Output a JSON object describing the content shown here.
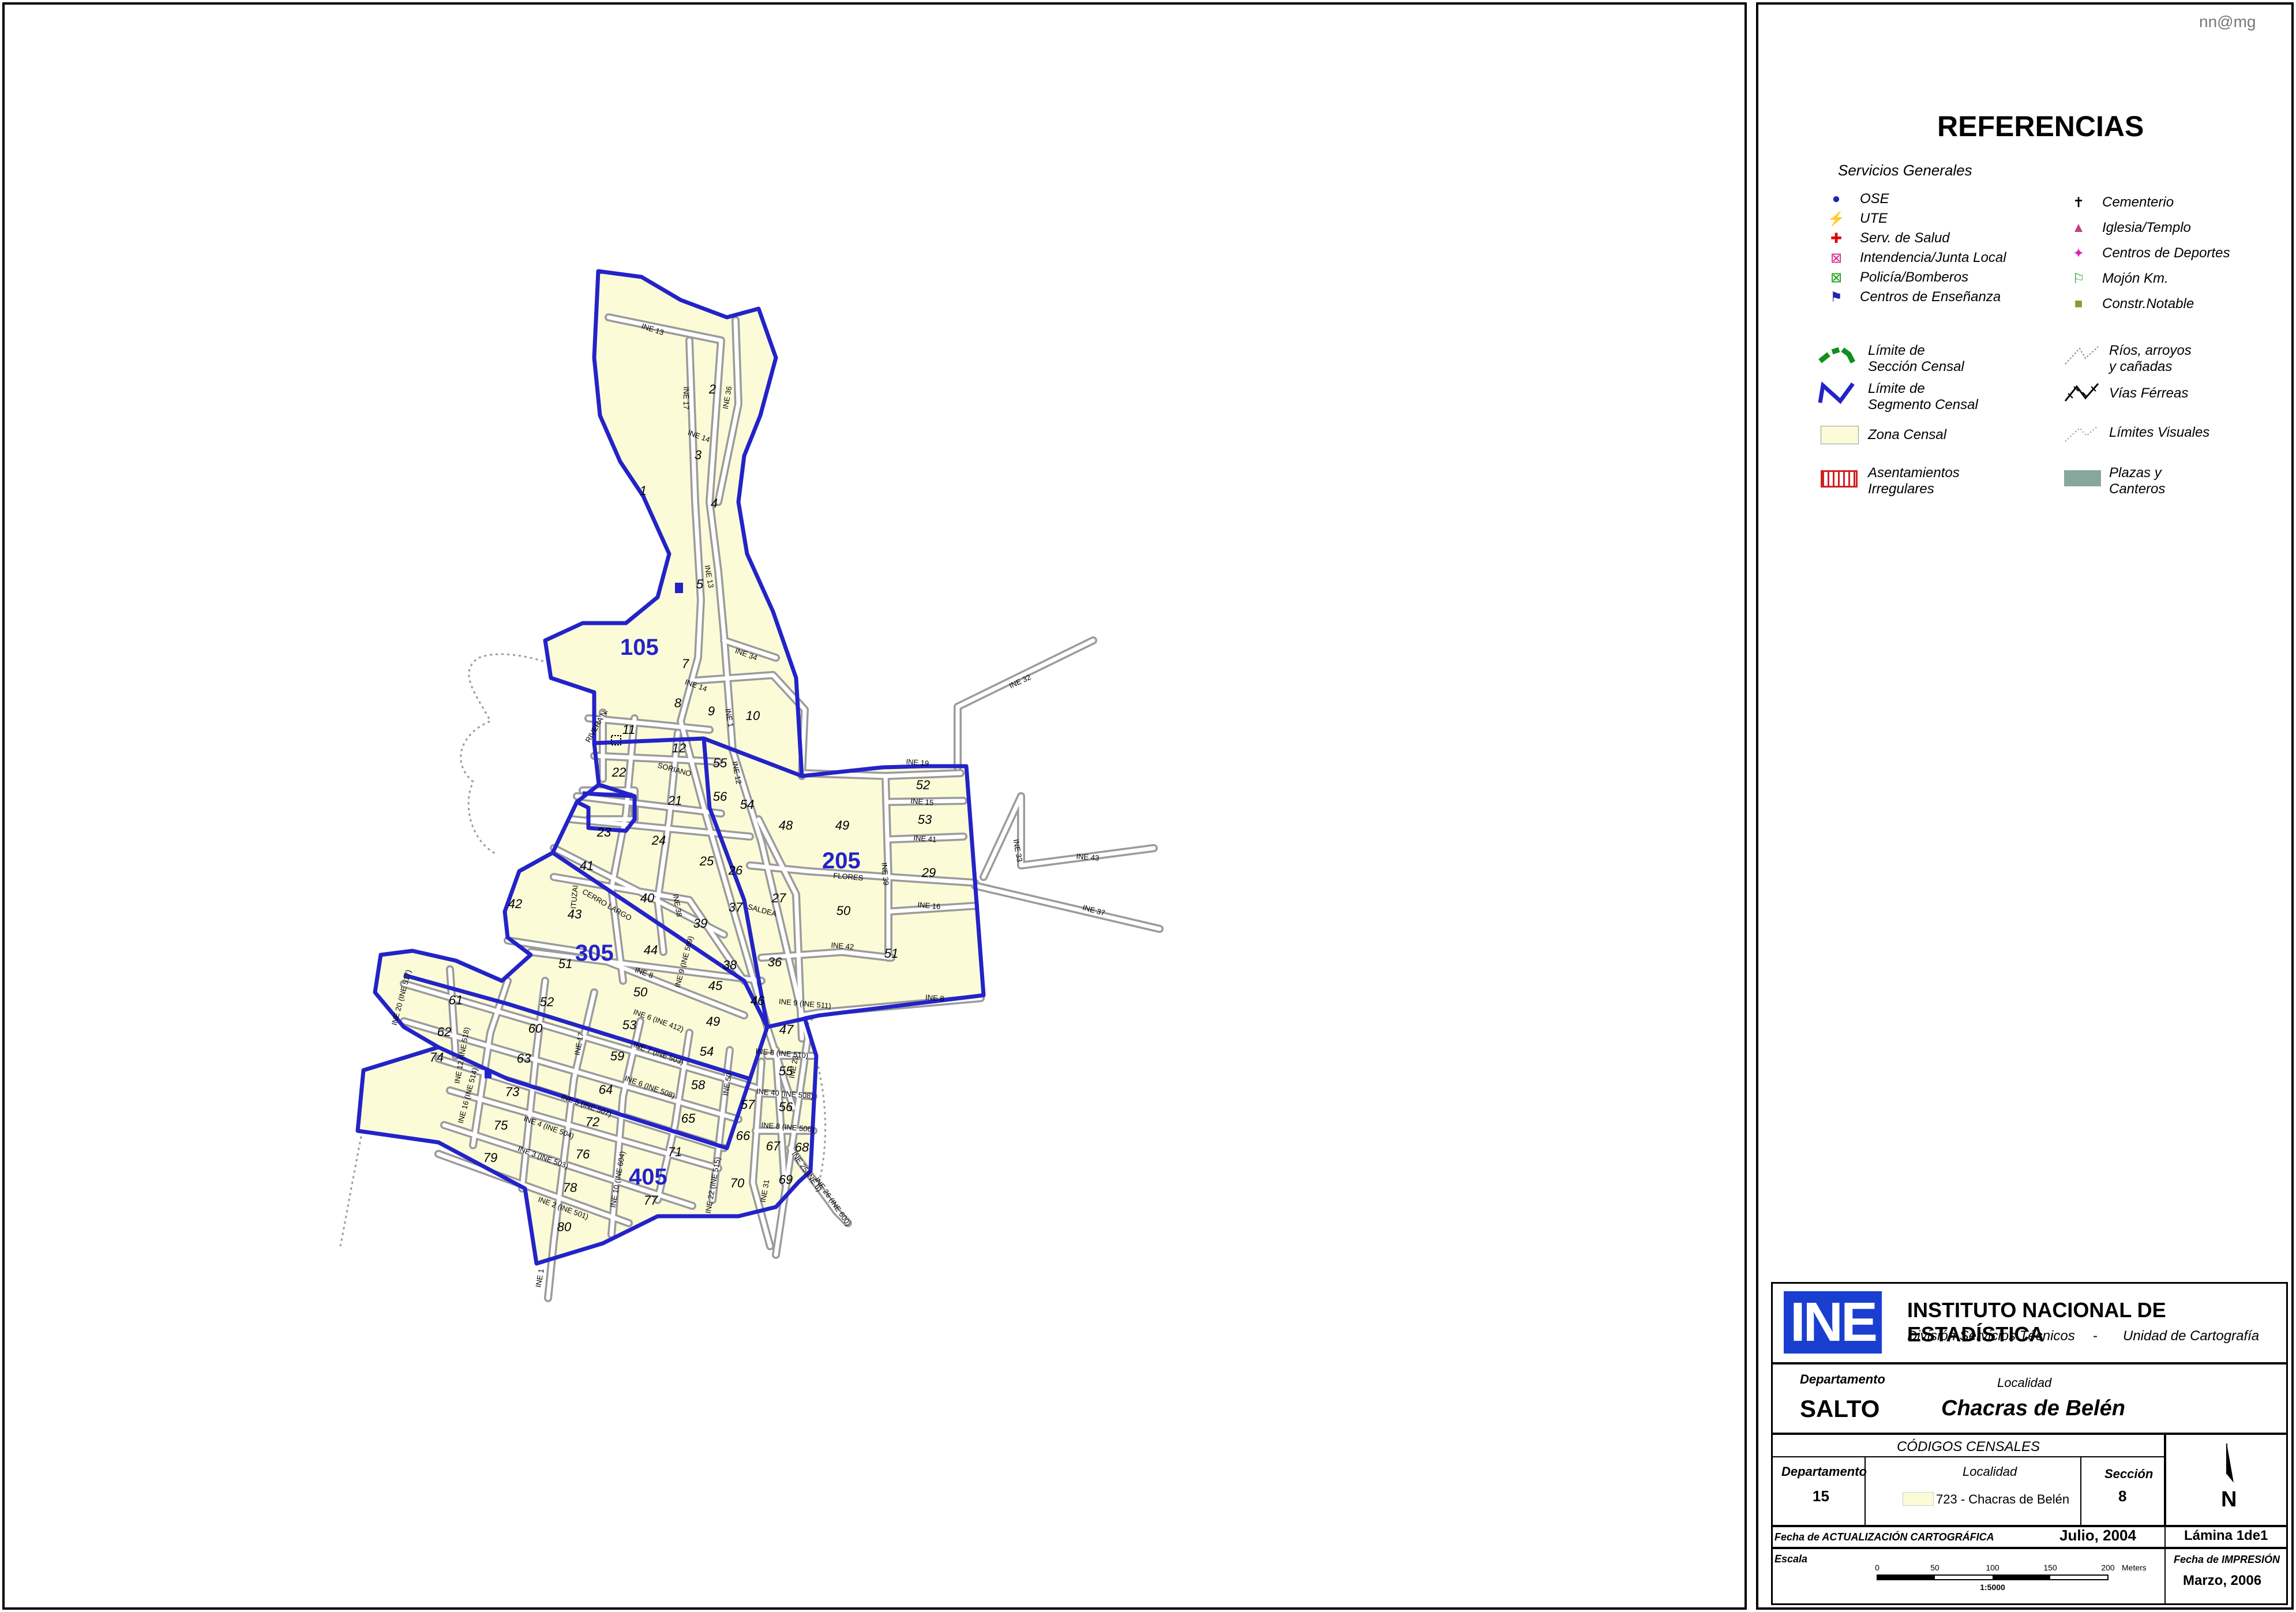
{
  "author": "nn@mg",
  "legend": {
    "title": "REFERENCIAS",
    "section_title": "Servicios Generales",
    "services_left": [
      {
        "label": "OSE",
        "icon": "water-drop-icon",
        "color": "#2323b0"
      },
      {
        "label": "UTE",
        "icon": "lightning-icon",
        "color": "#e8a000"
      },
      {
        "label": "Serv. de Salud",
        "icon": "red-cross-icon",
        "color": "#e00000"
      },
      {
        "label": "Intendencia/Junta Local",
        "icon": "municipal-box-icon",
        "color": "#d0208a"
      },
      {
        "label": "Policía/Bomberos",
        "icon": "police-box-icon",
        "color": "#10a010"
      },
      {
        "label": "Centros de Enseñanza",
        "icon": "school-flag-icon",
        "color": "#2323b0"
      }
    ],
    "services_right": [
      {
        "label": "Cementerio",
        "icon": "cemetery-cross-icon",
        "color": "#000000"
      },
      {
        "label": "Iglesia/Templo",
        "icon": "church-icon",
        "color": "#c04080"
      },
      {
        "label": "Centros de Deportes",
        "icon": "runner-icon",
        "color": "#e020c0"
      },
      {
        "label": "Mojón Km.",
        "icon": "milestone-flag-icon",
        "color": "#10a010"
      },
      {
        "label": "Constr.Notable",
        "icon": "notable-square-icon",
        "color": "#8a9a30"
      }
    ],
    "limite_seccion": [
      "Límite de",
      "Sección Censal"
    ],
    "limite_segmento": [
      "Límite de",
      "Segmento Censal"
    ],
    "zona_censal": "Zona Censal",
    "asentamientos": [
      "Asentamientos",
      "Irregulares"
    ],
    "rios": [
      "Ríos, arroyos",
      "y cañadas"
    ],
    "vias": "Vías Férreas",
    "limites_visuales": "Límites  Visuales",
    "plazas": [
      "Plazas y",
      "Canteros"
    ],
    "colors": {
      "zona": "#fbfbd8",
      "segmento": "#2323c8",
      "seccion": "#10901a",
      "plaza": "#86a89a",
      "asentamiento": "#d02020"
    }
  },
  "institution": {
    "logo_text": "INE",
    "name": "INSTITUTO NACIONAL DE ESTADÍSTICA",
    "division": "División Servicios Técnicos",
    "separator": "-",
    "unit": "Unidad de Cartografía"
  },
  "location": {
    "dept_label": "Departamento",
    "dept_value": "SALTO",
    "loc_label": "Localidad",
    "loc_value": "Chacras de Belén"
  },
  "codes": {
    "title": "CÓDIGOS CENSALES",
    "dept_label": "Departamento",
    "dept_value": "15",
    "loc_label": "Localidad",
    "loc_value": "723 - Chacras de Belén",
    "sec_label": "Sección",
    "sec_value": "8"
  },
  "dates": {
    "update_label": "Fecha de ACTUALIZACIÓN CARTOGRÁFICA",
    "update_value": "Julio, 2004",
    "sheet": "Lámina 1de1",
    "scale_label": "Escala",
    "scale_ticks": [
      "0",
      "50",
      "100",
      "150",
      "200"
    ],
    "scale_units": "Meters",
    "scale_ratio": "1:5000",
    "print_label": [
      "Fecha de",
      "IMPRESIÓN"
    ],
    "print_value": "Marzo, 2006",
    "north": "N"
  },
  "map": {
    "sections": [
      "105",
      "205",
      "305",
      "405"
    ],
    "zones": [
      [
        "1",
        "1115",
        "858"
      ],
      [
        "2",
        "1235",
        "682"
      ],
      [
        "3",
        "1210",
        "796"
      ],
      [
        "4",
        "1238",
        "880"
      ],
      [
        "5",
        "1213",
        "1020"
      ],
      [
        "7",
        "1188",
        "1158"
      ],
      [
        "8",
        "1175",
        "1226"
      ],
      [
        "9",
        "1233",
        "1240"
      ],
      [
        "10",
        "1305",
        "1248"
      ],
      [
        "11",
        "1090",
        "1272"
      ],
      [
        "12",
        "1177",
        "1304"
      ],
      [
        "21",
        "1170",
        "1395"
      ],
      [
        "22",
        "1073",
        "1346"
      ],
      [
        "23",
        "1047",
        "1450"
      ],
      [
        "24",
        "1142",
        "1464"
      ],
      [
        "25",
        "1225",
        "1500"
      ],
      [
        "26",
        "1275",
        "1516"
      ],
      [
        "27",
        "1350",
        "1564"
      ],
      [
        "29",
        "1610",
        "1520"
      ],
      [
        "36",
        "1343",
        "1675"
      ],
      [
        "37",
        "1275",
        "1580"
      ],
      [
        "38",
        "1265",
        "1680"
      ],
      [
        "39",
        "1214",
        "1608"
      ],
      [
        "40",
        "1122",
        "1564"
      ],
      [
        "41",
        "1017",
        "1508"
      ],
      [
        "42",
        "893",
        "1574"
      ],
      [
        "43",
        "996",
        "1592"
      ],
      [
        "44",
        "1128",
        "1654"
      ],
      [
        "45",
        "1240",
        "1716"
      ],
      [
        "46",
        "1313",
        "1742"
      ],
      [
        "47",
        "1363",
        "1792"
      ],
      [
        "48",
        "1362",
        "1438"
      ],
      [
        "49",
        "1460",
        "1438"
      ],
      [
        "50",
        "1462",
        "1586"
      ],
      [
        "51",
        "980",
        "1678"
      ],
      [
        "52",
        "1600",
        "1368"
      ],
      [
        "53",
        "1603",
        "1428"
      ],
      [
        "54",
        "1295",
        "1402"
      ],
      [
        "55",
        "1248",
        "1330"
      ],
      [
        "56",
        "1248",
        "1388"
      ],
      [
        "61",
        "790",
        "1741"
      ],
      [
        "62",
        "770",
        "1796"
      ],
      [
        "63",
        "908",
        "1842"
      ],
      [
        "64",
        "1050",
        "1896"
      ],
      [
        "65",
        "1193",
        "1946"
      ],
      [
        "66",
        "1288",
        "1976"
      ],
      [
        "67",
        "1340",
        "1994"
      ],
      [
        "68",
        "1390",
        "1996"
      ],
      [
        "69",
        "1362",
        "2052"
      ],
      [
        "70",
        "1278",
        "2058"
      ],
      [
        "71",
        "1170",
        "2004"
      ],
      [
        "72",
        "1027",
        "1952"
      ],
      [
        "73",
        "888",
        "1900"
      ],
      [
        "74",
        "757",
        "1840"
      ],
      [
        "75",
        "868",
        "1958"
      ],
      [
        "76",
        "1010",
        "2008"
      ],
      [
        "77",
        "1128",
        "2088"
      ],
      [
        "78",
        "988",
        "2066"
      ],
      [
        "79",
        "850",
        "2014"
      ],
      [
        "80",
        "978",
        "2134"
      ]
    ],
    "zones_lower": [
      [
        "50",
        "1110",
        "1727"
      ],
      [
        "52",
        "948",
        "1744"
      ],
      [
        "53",
        "1091",
        "1784"
      ],
      [
        "49",
        "1236",
        "1778"
      ],
      [
        "60",
        "928",
        "1790"
      ],
      [
        "59",
        "1070",
        "1838"
      ],
      [
        "54",
        "1225",
        "1830"
      ],
      [
        "58",
        "1210",
        "1888"
      ],
      [
        "55",
        "1362",
        "1864"
      ],
      [
        "56",
        "1362",
        "1926"
      ],
      [
        "57",
        "1296",
        "1922"
      ],
      [
        "51",
        "1545",
        "1660"
      ]
    ],
    "streets": [
      [
        "INE 13",
        "1130",
        "575",
        "18"
      ],
      [
        "INE 17",
        "1185",
        "690",
        "90"
      ],
      [
        "INE 36",
        "1265",
        "690",
        "-80"
      ],
      [
        "INE 14",
        "1210",
        "760",
        "20"
      ],
      [
        "INE 13",
        "1225",
        "1000",
        "80"
      ],
      [
        "INE 34",
        "1292",
        "1138",
        "20"
      ],
      [
        "INE 32",
        "1770",
        "1185",
        "-25"
      ],
      [
        "INE 14",
        "1205",
        "1192",
        "20"
      ],
      [
        "RIVERA N.",
        "1038",
        "1260",
        "-60"
      ],
      [
        "SORIANO",
        "1168",
        "1338",
        "15"
      ],
      [
        "INE 12",
        "1273",
        "1340",
        "80"
      ],
      [
        "INE 19",
        "1590",
        "1326",
        "5"
      ],
      [
        "INE 15",
        "1598",
        "1394",
        "5"
      ],
      [
        "INE 41",
        "1603",
        "1458",
        "5"
      ],
      [
        "INE 33",
        "1760",
        "1475",
        "80"
      ],
      [
        "INE 43",
        "1885",
        "1490",
        "5"
      ],
      [
        "FLORES",
        "1470",
        "1524",
        "5"
      ],
      [
        "INE 39",
        "1530",
        "1515",
        "85"
      ],
      [
        "INE 16",
        "1610",
        "1574",
        "5"
      ],
      [
        "INE 37",
        "1895",
        "1582",
        "15"
      ],
      [
        "SALDEA",
        "1320",
        "1582",
        "15"
      ],
      [
        "ITUZAI",
        "1000",
        "1555",
        "-85"
      ],
      [
        "CERRO LARGO",
        "1050",
        "1572",
        "30"
      ],
      [
        "INE 38",
        "1170",
        "1570",
        "80"
      ],
      [
        "INE 42",
        "1460",
        "1644",
        "5"
      ],
      [
        "INE 9 (INE 509)",
        "1190",
        "1668",
        "-75"
      ],
      [
        "INE 8",
        "1115",
        "1690",
        "20"
      ],
      [
        "INE 9 (INE 511)",
        "1395",
        "1744",
        "5"
      ],
      [
        "INE 8",
        "1620",
        "1734",
        "5"
      ],
      [
        "INE 20 (INE 517)",
        "700",
        "1730",
        "-75"
      ],
      [
        "INE 12 (INE 518)",
        "805",
        "1830",
        "-80"
      ],
      [
        "INE 17",
        "1008",
        "1810",
        "-80"
      ],
      [
        "INE 6 (INE 412)",
        "1140",
        "1773",
        "20"
      ],
      [
        "INE 7 (INE 503)",
        "1140",
        "1830",
        "20"
      ],
      [
        "INE 8 (INE 510)",
        "1355",
        "1830",
        "5"
      ],
      [
        "INE 6 (INE 508)",
        "1125",
        "1888",
        "20"
      ],
      [
        "INE 40 (INE 508)",
        "1360",
        "1900",
        "5"
      ],
      [
        "INE 8 (INE 506)",
        "1365",
        "1958",
        "5"
      ],
      [
        "INE 5 (INE 507)",
        "1015",
        "1920",
        "20"
      ],
      [
        "INE 4 (INE 504)",
        "950",
        "1958",
        "20"
      ],
      [
        "INE 3 (INE 503)",
        "940",
        "2010",
        "20"
      ],
      [
        "INE 10 (INE 604)",
        "1075",
        "2045",
        "-80"
      ],
      [
        "INE 2 (INE 501)",
        "975",
        "2098",
        "20"
      ],
      [
        "INE 31",
        "1330",
        "2065",
        "-80"
      ],
      [
        "INE 22 (INE 515)",
        "1240",
        "2055",
        "-80"
      ],
      [
        "INE 23",
        "1380",
        "1850",
        "-80"
      ],
      [
        "INE 1",
        "940",
        "2216",
        "-80"
      ],
      [
        "INE 50",
        "1265",
        "1880",
        "-80"
      ],
      [
        "INE 25(INE 6)",
        "1395",
        "2033",
        "55"
      ],
      [
        "INE 26 (INE 600)",
        "1440",
        "2085",
        "55"
      ],
      [
        "INE 16 (INE 514)",
        "815",
        "1900",
        "-75"
      ],
      [
        "INE 1",
        "1260",
        "1245",
        "80"
      ]
    ]
  }
}
